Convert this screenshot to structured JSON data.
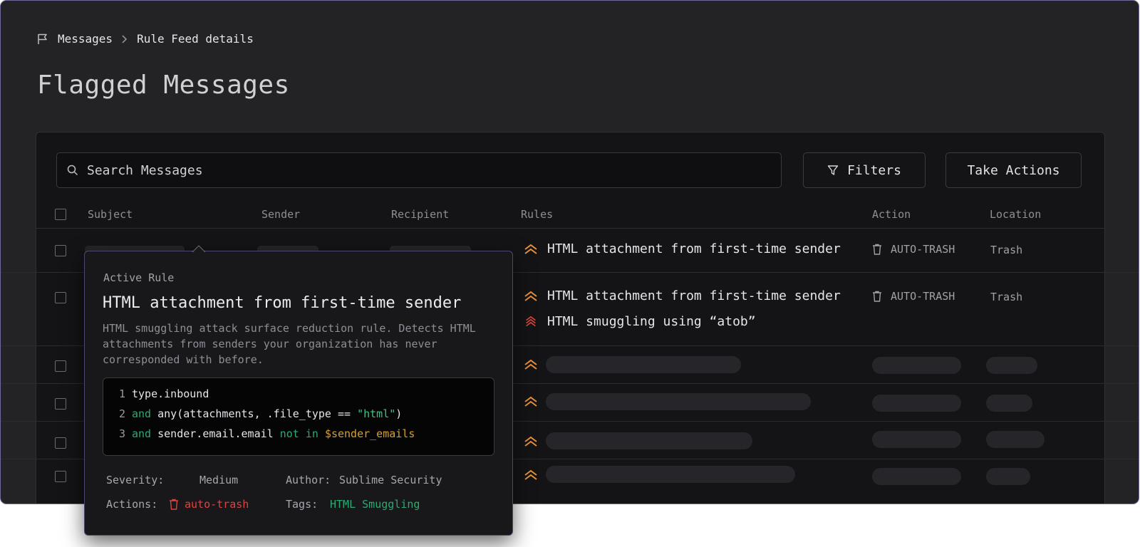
{
  "breadcrumb": {
    "root": "Messages",
    "current": "Rule Feed details"
  },
  "page_title": "Flagged Messages",
  "search": {
    "placeholder": "Search Messages"
  },
  "buttons": {
    "filters": "Filters",
    "take_actions": "Take Actions"
  },
  "table": {
    "headers": {
      "subject": "Subject",
      "sender": "Sender",
      "recipient": "Recipient",
      "rules": "Rules",
      "action": "Action",
      "location": "Location"
    },
    "rows": [
      {
        "rules": [
          "HTML attachment from first-time sender"
        ],
        "action": "AUTO-TRASH",
        "location": "Trash"
      },
      {
        "rules": [
          "HTML attachment from first-time sender",
          "HTML smuggling using “atob”"
        ],
        "action": "AUTO-TRASH",
        "location": "Trash"
      }
    ]
  },
  "popup": {
    "label": "Active Rule",
    "title": "HTML attachment from first-time sender",
    "description": "HTML smuggling attack surface reduction rule. Detects HTML attachments from senders your organization has never corresponded with before.",
    "code": {
      "line1": {
        "n": "1",
        "text": "type.inbound"
      },
      "line2": {
        "n": "2",
        "kw": "and",
        "text": " any(attachments, .file_type == ",
        "str": "\"html\"",
        "end": ")"
      },
      "line3": {
        "n": "3",
        "kw": "and",
        "text": " sender.email.email ",
        "kw2": "not in",
        "var": "$sender_emails"
      }
    },
    "severity_label": "Severity:",
    "severity": "Medium",
    "author_label": "Author:",
    "author": "Sublime Security",
    "actions_label": "Actions:",
    "action": "auto-trash",
    "tags_label": "Tags:",
    "tag": "HTML Smuggling"
  },
  "colors": {
    "accent_orange": "#e8913a",
    "accent_red": "#e0433e",
    "accent_green": "#2fa871",
    "background": "#232326"
  }
}
